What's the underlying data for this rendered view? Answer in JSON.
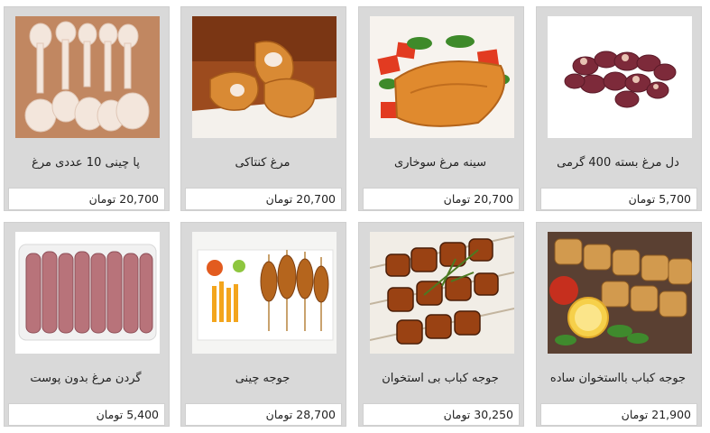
{
  "products": [
    {
      "title": "پا چینی 10 عددی مرغ",
      "price": "20,700 تومان",
      "icon": "chicken-feet-photo"
    },
    {
      "title": "مرغ کنتاکی",
      "price": "20,700 تومان",
      "icon": "fried-chicken-photo"
    },
    {
      "title": "سینه مرغ سوخاری",
      "price": "20,700 تومان",
      "icon": "breaded-chicken-breast-photo"
    },
    {
      "title": "دل مرغ بسته 400 گرمی",
      "price": "5,700 تومان",
      "icon": "chicken-hearts-photo"
    },
    {
      "title": "گردن مرغ بدون پوست",
      "price": "5,400 تومان",
      "icon": "chicken-necks-photo"
    },
    {
      "title": "جوجه چینی",
      "price": "28,700 تومان",
      "icon": "chicken-skewers-photo"
    },
    {
      "title": "جوجه کباب بی استخوان",
      "price": "30,250 تومان",
      "icon": "grilled-kebab-photo"
    },
    {
      "title": "جوجه کباب بااستخوان ساده",
      "price": "21,900 تومان",
      "icon": "bone-in-kebab-photo"
    }
  ]
}
